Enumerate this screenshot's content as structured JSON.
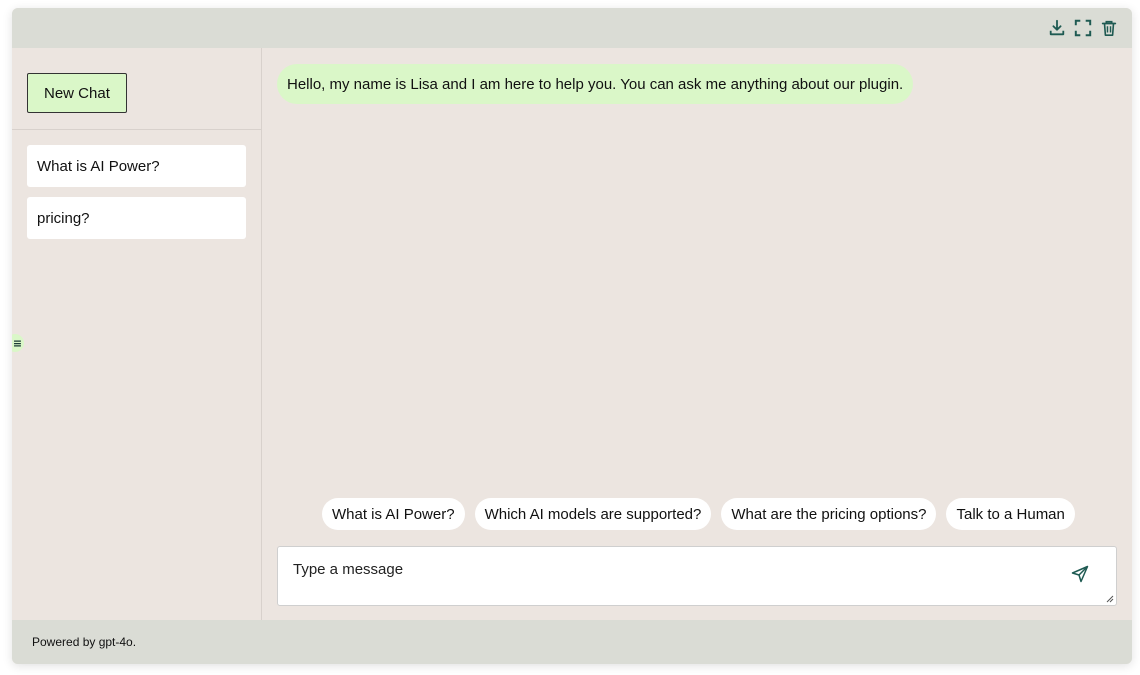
{
  "toolbar": {
    "icons": [
      "download-icon",
      "fullscreen-icon",
      "trash-icon"
    ],
    "icon_color": "#1e5a52"
  },
  "sidebar": {
    "new_chat_label": "New Chat",
    "conversations": [
      {
        "label": "What is AI Power?"
      },
      {
        "label": "pricing?"
      }
    ]
  },
  "chat": {
    "messages": [
      {
        "role": "bot",
        "text": "Hello, my name is Lisa and I am here to help you. You can ask me anything about our plugin."
      }
    ],
    "suggestions": [
      {
        "label": "What is AI Power?"
      },
      {
        "label": "Which AI models are supported?"
      },
      {
        "label": "What are the pricing options?"
      },
      {
        "label": "Talk to a Human"
      }
    ],
    "input": {
      "placeholder": "Type a message",
      "value": ""
    }
  },
  "footer": {
    "text": "Powered by gpt-4o."
  },
  "colors": {
    "background": "#ece5e0",
    "bars": "#dadcd5",
    "accent_bubble": "#daf7c8",
    "icon": "#1e5a52"
  }
}
